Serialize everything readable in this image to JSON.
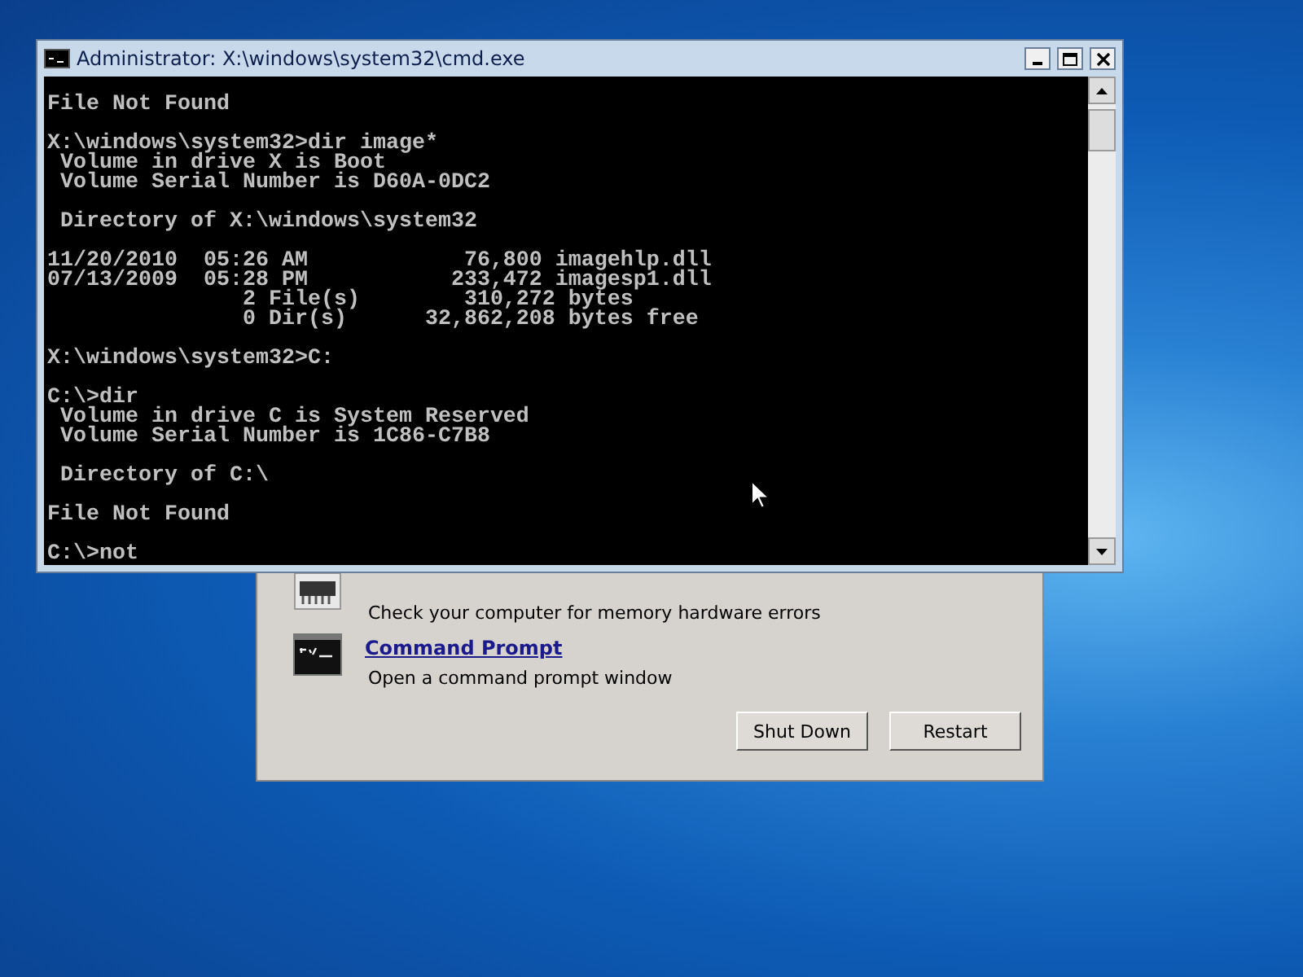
{
  "console_window": {
    "title": "Administrator: X:\\windows\\system32\\cmd.exe",
    "blocks": [
      [
        "File Not Found"
      ],
      [
        "X:\\windows\\system32>dir image*",
        " Volume in drive X is Boot",
        " Volume Serial Number is D60A-0DC2"
      ],
      [
        " Directory of X:\\windows\\system32"
      ],
      [
        "11/20/2010  05:26 AM            76,800 imagehlp.dll",
        "07/13/2009  05:28 PM           233,472 imagesp1.dll",
        "               2 File(s)        310,272 bytes",
        "               0 Dir(s)      32,862,208 bytes free"
      ],
      [
        "X:\\windows\\system32>C:"
      ],
      [
        "C:\\>dir",
        " Volume in drive C is System Reserved",
        " Volume Serial Number is 1C86-C7B8"
      ],
      [
        " Directory of C:\\"
      ],
      [
        "File Not Found"
      ],
      [
        "C:\\>not"
      ]
    ]
  },
  "recovery_options": {
    "items": [
      {
        "kind": "memory",
        "description": "Check your computer for memory hardware errors"
      },
      {
        "kind": "prompt",
        "title": "Command Prompt",
        "description": "Open a command prompt window"
      }
    ],
    "buttons": [
      "Shut Down",
      "Restart"
    ]
  }
}
